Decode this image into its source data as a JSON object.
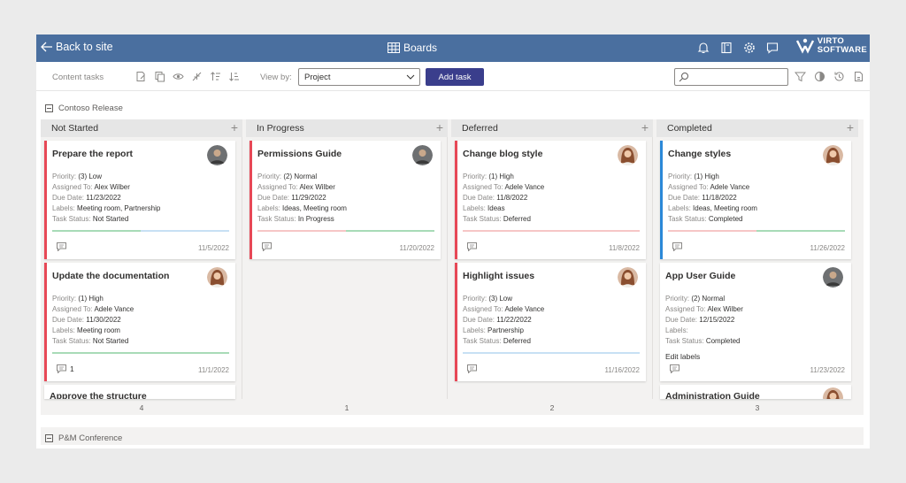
{
  "topbar": {
    "back_label": "Back to site",
    "boards_label": "Boards",
    "logo_line1": "VIRTO",
    "logo_line2": "SOFTWARE",
    "icons": [
      "bell-icon",
      "book-icon",
      "gear-icon",
      "chat-icon"
    ]
  },
  "toolbar": {
    "title": "Content tasks",
    "view_by_label": "View by:",
    "view_by_value": "Project",
    "add_task_label": "Add task",
    "search_placeholder": ""
  },
  "groups": [
    {
      "name": "Contoso Release"
    },
    {
      "name": "P&M Conference"
    }
  ],
  "columns": [
    {
      "title": "Not Started",
      "count": "4"
    },
    {
      "title": "In Progress",
      "count": "1"
    },
    {
      "title": "Deferred",
      "count": "2"
    },
    {
      "title": "Completed",
      "count": "3"
    }
  ],
  "field_labels": {
    "priority": "Priority:",
    "assigned": "Assigned To:",
    "due": "Due Date:",
    "labels": "Labels:",
    "status": "Task Status:"
  },
  "cards": {
    "prepare": {
      "title": "Prepare the report",
      "priority": "(3) Low",
      "assigned": "Alex Wilber",
      "due": "11/23/2022",
      "labels": "Meeting room, Partnership",
      "status": "Not Started",
      "date": "11/5/2022",
      "progress": [
        0.5,
        0.5
      ]
    },
    "update": {
      "title": "Update the documentation",
      "priority": "(1) High",
      "assigned": "Adele Vance",
      "due": "11/30/2022",
      "labels": "Meeting room",
      "status": "Not Started",
      "comments": "1",
      "date": "11/1/2022",
      "progress": [
        1.0,
        0.0
      ]
    },
    "approve": {
      "title": "Approve the structure"
    },
    "permissions": {
      "title": "Permissions Guide",
      "priority": "(2) Normal",
      "assigned": "Alex Wilber",
      "due": "11/29/2022",
      "labels": "Ideas, Meeting room",
      "status": "In Progress",
      "date": "11/20/2022",
      "progress": [
        0.5,
        0.5
      ]
    },
    "blog": {
      "title": "Change blog style",
      "priority": "(1) High",
      "assigned": "Adele Vance",
      "due": "11/8/2022",
      "labels": "Ideas",
      "status": "Deferred",
      "date": "11/8/2022",
      "progress": [
        1.0,
        0.0
      ]
    },
    "highlight": {
      "title": "Highlight issues",
      "priority": "(3) Low",
      "assigned": "Adele Vance",
      "due": "11/22/2022",
      "labels": "Partnership",
      "status": "Deferred",
      "date": "11/16/2022",
      "progress": [
        0.0,
        1.0
      ]
    },
    "styles": {
      "title": "Change styles",
      "priority": "(1) High",
      "assigned": "Adele Vance",
      "due": "11/18/2022",
      "labels": "Ideas, Meeting room",
      "status": "Completed",
      "date": "11/26/2022",
      "progress": [
        0.5,
        0.5
      ]
    },
    "appguide": {
      "title": "App User Guide",
      "priority": "(2) Normal",
      "assigned": "Alex Wilber",
      "due": "12/15/2022",
      "labels": "",
      "status": "Completed",
      "edit_labels": "Edit labels",
      "date": "11/23/2022"
    },
    "admin": {
      "title": "Administration Guide"
    }
  },
  "colors": {
    "header_bg": "#4a6f9f",
    "primary_button": "#3a3e8c",
    "card_accent_red": "#e74856",
    "card_accent_blue": "#2b88d8",
    "progress_green": "#a8dbb7",
    "progress_blue": "#c7e0f4",
    "progress_pink": "#f6c6c6"
  }
}
